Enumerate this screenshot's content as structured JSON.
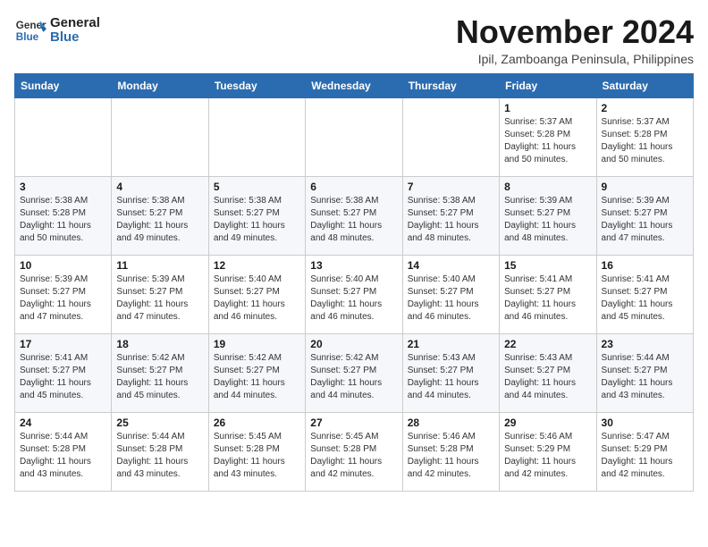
{
  "logo": {
    "name_line1": "General",
    "name_line2": "Blue"
  },
  "header": {
    "month": "November 2024",
    "location": "Ipil, Zamboanga Peninsula, Philippines"
  },
  "weekdays": [
    "Sunday",
    "Monday",
    "Tuesday",
    "Wednesday",
    "Thursday",
    "Friday",
    "Saturday"
  ],
  "weeks": [
    [
      {
        "day": "",
        "info": ""
      },
      {
        "day": "",
        "info": ""
      },
      {
        "day": "",
        "info": ""
      },
      {
        "day": "",
        "info": ""
      },
      {
        "day": "",
        "info": ""
      },
      {
        "day": "1",
        "info": "Sunrise: 5:37 AM\nSunset: 5:28 PM\nDaylight: 11 hours and 50 minutes."
      },
      {
        "day": "2",
        "info": "Sunrise: 5:37 AM\nSunset: 5:28 PM\nDaylight: 11 hours and 50 minutes."
      }
    ],
    [
      {
        "day": "3",
        "info": "Sunrise: 5:38 AM\nSunset: 5:28 PM\nDaylight: 11 hours and 50 minutes."
      },
      {
        "day": "4",
        "info": "Sunrise: 5:38 AM\nSunset: 5:27 PM\nDaylight: 11 hours and 49 minutes."
      },
      {
        "day": "5",
        "info": "Sunrise: 5:38 AM\nSunset: 5:27 PM\nDaylight: 11 hours and 49 minutes."
      },
      {
        "day": "6",
        "info": "Sunrise: 5:38 AM\nSunset: 5:27 PM\nDaylight: 11 hours and 48 minutes."
      },
      {
        "day": "7",
        "info": "Sunrise: 5:38 AM\nSunset: 5:27 PM\nDaylight: 11 hours and 48 minutes."
      },
      {
        "day": "8",
        "info": "Sunrise: 5:39 AM\nSunset: 5:27 PM\nDaylight: 11 hours and 48 minutes."
      },
      {
        "day": "9",
        "info": "Sunrise: 5:39 AM\nSunset: 5:27 PM\nDaylight: 11 hours and 47 minutes."
      }
    ],
    [
      {
        "day": "10",
        "info": "Sunrise: 5:39 AM\nSunset: 5:27 PM\nDaylight: 11 hours and 47 minutes."
      },
      {
        "day": "11",
        "info": "Sunrise: 5:39 AM\nSunset: 5:27 PM\nDaylight: 11 hours and 47 minutes."
      },
      {
        "day": "12",
        "info": "Sunrise: 5:40 AM\nSunset: 5:27 PM\nDaylight: 11 hours and 46 minutes."
      },
      {
        "day": "13",
        "info": "Sunrise: 5:40 AM\nSunset: 5:27 PM\nDaylight: 11 hours and 46 minutes."
      },
      {
        "day": "14",
        "info": "Sunrise: 5:40 AM\nSunset: 5:27 PM\nDaylight: 11 hours and 46 minutes."
      },
      {
        "day": "15",
        "info": "Sunrise: 5:41 AM\nSunset: 5:27 PM\nDaylight: 11 hours and 46 minutes."
      },
      {
        "day": "16",
        "info": "Sunrise: 5:41 AM\nSunset: 5:27 PM\nDaylight: 11 hours and 45 minutes."
      }
    ],
    [
      {
        "day": "17",
        "info": "Sunrise: 5:41 AM\nSunset: 5:27 PM\nDaylight: 11 hours and 45 minutes."
      },
      {
        "day": "18",
        "info": "Sunrise: 5:42 AM\nSunset: 5:27 PM\nDaylight: 11 hours and 45 minutes."
      },
      {
        "day": "19",
        "info": "Sunrise: 5:42 AM\nSunset: 5:27 PM\nDaylight: 11 hours and 44 minutes."
      },
      {
        "day": "20",
        "info": "Sunrise: 5:42 AM\nSunset: 5:27 PM\nDaylight: 11 hours and 44 minutes."
      },
      {
        "day": "21",
        "info": "Sunrise: 5:43 AM\nSunset: 5:27 PM\nDaylight: 11 hours and 44 minutes."
      },
      {
        "day": "22",
        "info": "Sunrise: 5:43 AM\nSunset: 5:27 PM\nDaylight: 11 hours and 44 minutes."
      },
      {
        "day": "23",
        "info": "Sunrise: 5:44 AM\nSunset: 5:27 PM\nDaylight: 11 hours and 43 minutes."
      }
    ],
    [
      {
        "day": "24",
        "info": "Sunrise: 5:44 AM\nSunset: 5:28 PM\nDaylight: 11 hours and 43 minutes."
      },
      {
        "day": "25",
        "info": "Sunrise: 5:44 AM\nSunset: 5:28 PM\nDaylight: 11 hours and 43 minutes."
      },
      {
        "day": "26",
        "info": "Sunrise: 5:45 AM\nSunset: 5:28 PM\nDaylight: 11 hours and 43 minutes."
      },
      {
        "day": "27",
        "info": "Sunrise: 5:45 AM\nSunset: 5:28 PM\nDaylight: 11 hours and 42 minutes."
      },
      {
        "day": "28",
        "info": "Sunrise: 5:46 AM\nSunset: 5:28 PM\nDaylight: 11 hours and 42 minutes."
      },
      {
        "day": "29",
        "info": "Sunrise: 5:46 AM\nSunset: 5:29 PM\nDaylight: 11 hours and 42 minutes."
      },
      {
        "day": "30",
        "info": "Sunrise: 5:47 AM\nSunset: 5:29 PM\nDaylight: 11 hours and 42 minutes."
      }
    ]
  ]
}
